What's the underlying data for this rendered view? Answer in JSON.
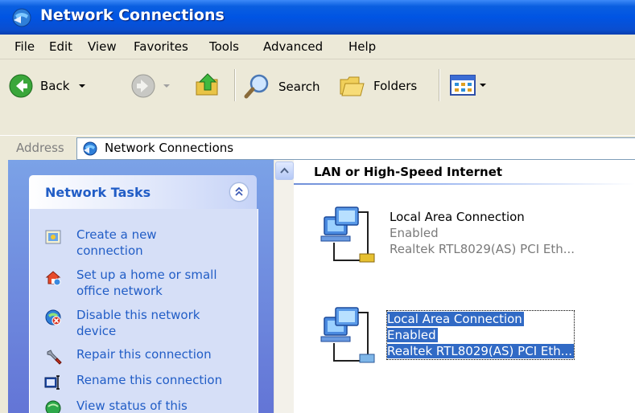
{
  "window": {
    "title": "Network Connections"
  },
  "menu": [
    "File",
    "Edit",
    "View",
    "Favorites",
    "Tools",
    "Advanced",
    "Help"
  ],
  "toolbar": {
    "back_label": "Back",
    "search_label": "Search",
    "folders_label": "Folders"
  },
  "address": {
    "label": "Address",
    "value": "Network Connections"
  },
  "tasks": {
    "title": "Network Tasks",
    "items": [
      {
        "line1": "Create a new",
        "line2": "connection",
        "icon": "new-connection-icon"
      },
      {
        "line1": "Set up a home or small",
        "line2": "office network",
        "icon": "home-network-icon"
      },
      {
        "line1": "Disable this network",
        "line2": "device",
        "icon": "disable-device-icon"
      },
      {
        "line1": "Repair this connection",
        "line2": "",
        "icon": "repair-icon"
      },
      {
        "line1": "Rename this connection",
        "line2": "",
        "icon": "rename-icon"
      },
      {
        "line1": "View status of this",
        "line2": "",
        "icon": "status-icon"
      }
    ]
  },
  "content": {
    "group_header": "LAN or High-Speed Internet",
    "connections": [
      {
        "name": "Local Area Connection",
        "status": "Enabled",
        "device": "Realtek RTL8029(AS) PCI Eth...",
        "selected": false
      },
      {
        "name": "Local Area Connection",
        "status": "Enabled",
        "device": "Realtek RTL8029(AS) PCI Eth...",
        "selected": true
      }
    ]
  },
  "colors": {
    "title_bar": "#0054e3",
    "task_link": "#215dc6",
    "selection": "#316ac5"
  }
}
